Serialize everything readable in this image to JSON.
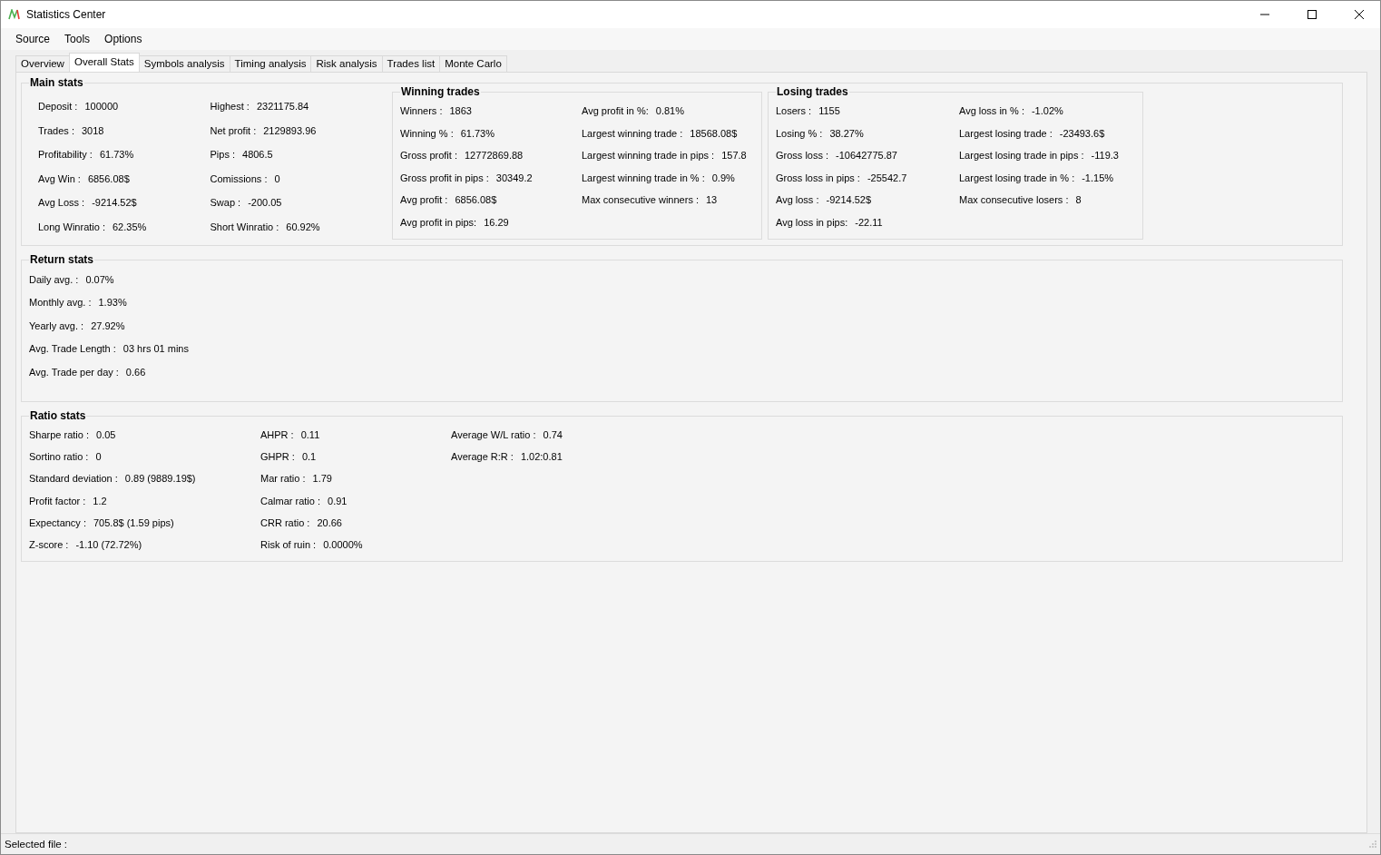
{
  "window": {
    "title": "Statistics Center"
  },
  "menu": [
    "Source",
    "Tools",
    "Options"
  ],
  "tabs": [
    {
      "label": "Overview",
      "selected": false
    },
    {
      "label": "Overall Stats",
      "selected": true
    },
    {
      "label": "Symbols analysis",
      "selected": false
    },
    {
      "label": "Timing analysis",
      "selected": false
    },
    {
      "label": "Risk analysis",
      "selected": false
    },
    {
      "label": "Trades list",
      "selected": false
    },
    {
      "label": "Monte Carlo",
      "selected": false
    }
  ],
  "main_stats": {
    "title": "Main stats",
    "columns": [
      [
        {
          "label": "Deposit :",
          "value": "100000"
        },
        {
          "label": "Trades :",
          "value": "3018"
        },
        {
          "label": "Profitability :",
          "value": "61.73%"
        },
        {
          "label": "Avg Win :",
          "value": "6856.08$"
        },
        {
          "label": "Avg Loss :",
          "value": "-9214.52$"
        },
        {
          "label": "Long Winratio :",
          "value": "62.35%"
        }
      ],
      [
        {
          "label": "Highest :",
          "value": "2321175.84"
        },
        {
          "label": "Net profit :",
          "value": "2129893.96"
        },
        {
          "label": "Pips :",
          "value": "4806.5"
        },
        {
          "label": "Comissions :",
          "value": "0"
        },
        {
          "label": "Swap :",
          "value": "-200.05"
        },
        {
          "label": "Short Winratio :",
          "value": "60.92%"
        }
      ]
    ]
  },
  "winning_trades": {
    "title": "Winning trades",
    "columns": [
      [
        {
          "label": "Winners :",
          "value": "1863"
        },
        {
          "label": "Winning % :",
          "value": "61.73%"
        },
        {
          "label": "Gross profit :",
          "value": "12772869.88"
        },
        {
          "label": "Gross profit in pips :",
          "value": "30349.2"
        },
        {
          "label": "Avg profit :",
          "value": "6856.08$"
        },
        {
          "label": "Avg profit in pips:",
          "value": "16.29"
        }
      ],
      [
        {
          "label": "Avg profit in %:",
          "value": "0.81%"
        },
        {
          "label": "Largest winning trade :",
          "value": "18568.08$"
        },
        {
          "label": "Largest winning trade in pips :",
          "value": "157.8"
        },
        {
          "label": "Largest winning trade in % :",
          "value": "0.9%"
        },
        {
          "label": "Max consecutive winners :",
          "value": "13"
        }
      ]
    ]
  },
  "losing_trades": {
    "title": "Losing trades",
    "columns": [
      [
        {
          "label": "Losers :",
          "value": "1155"
        },
        {
          "label": "Losing % :",
          "value": "38.27%"
        },
        {
          "label": "Gross loss :",
          "value": "-10642775.87"
        },
        {
          "label": "Gross loss in pips :",
          "value": "-25542.7"
        },
        {
          "label": "Avg loss :",
          "value": "-9214.52$"
        },
        {
          "label": "Avg loss in pips:",
          "value": "-22.11"
        }
      ],
      [
        {
          "label": "Avg loss in % :",
          "value": "-1.02%"
        },
        {
          "label": "Largest losing trade :",
          "value": "-23493.6$"
        },
        {
          "label": "Largest losing trade in pips :",
          "value": "-119.3"
        },
        {
          "label": "Largest losing trade in % :",
          "value": "-1.15%"
        },
        {
          "label": "Max consecutive losers :",
          "value": "8"
        }
      ]
    ]
  },
  "return_stats": {
    "title": "Return stats",
    "columns": [
      [
        {
          "label": "Daily avg. :",
          "value": "0.07%"
        },
        {
          "label": "Monthly avg. :",
          "value": "1.93%"
        },
        {
          "label": "Yearly avg. :",
          "value": "27.92%"
        },
        {
          "label": "Avg. Trade Length :",
          "value": "03 hrs 01 mins"
        },
        {
          "label": "Avg. Trade per day :",
          "value": "0.66"
        }
      ]
    ]
  },
  "ratio_stats": {
    "title": "Ratio stats",
    "columns": [
      [
        {
          "label": "Sharpe ratio :",
          "value": "0.05"
        },
        {
          "label": "Sortino ratio :",
          "value": "0"
        },
        {
          "label": "Standard deviation :",
          "value": "0.89 (9889.19$)"
        },
        {
          "label": "Profit factor :",
          "value": "1.2"
        },
        {
          "label": "Expectancy :",
          "value": "705.8$ (1.59 pips)"
        },
        {
          "label": "Z-score :",
          "value": "-1.10 (72.72%)"
        }
      ],
      [
        {
          "label": "AHPR :",
          "value": "0.11"
        },
        {
          "label": "GHPR :",
          "value": "0.1"
        },
        {
          "label": "Mar ratio :",
          "value": "1.79"
        },
        {
          "label": "Calmar ratio :",
          "value": "0.91"
        },
        {
          "label": "CRR ratio :",
          "value": "20.66"
        },
        {
          "label": "Risk of ruin :",
          "value": "0.0000%"
        }
      ],
      [
        {
          "label": "Average W/L ratio :",
          "value": "0.74"
        },
        {
          "label": "Average R:R :",
          "value": "1.02:0.81"
        }
      ]
    ]
  },
  "status_bar": {
    "label": "Selected file :"
  }
}
